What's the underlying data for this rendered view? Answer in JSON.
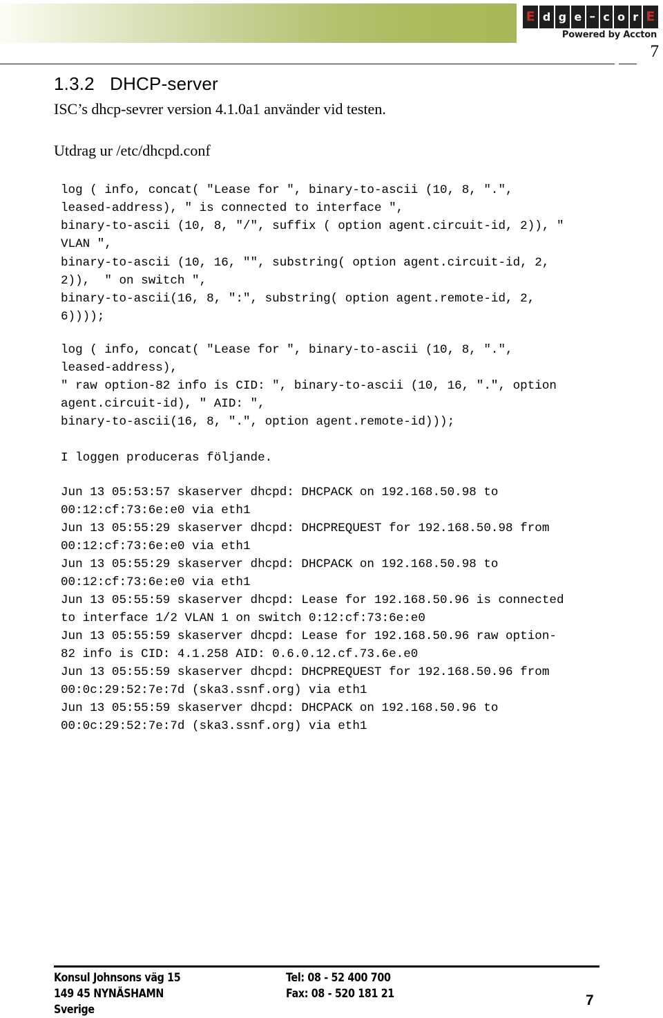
{
  "header": {
    "logo": {
      "tiles": [
        {
          "char": "E",
          "style": "accent"
        },
        {
          "char": "d",
          "style": "plain"
        },
        {
          "char": "g",
          "style": "plain"
        },
        {
          "char": "e",
          "style": "plain"
        },
        {
          "char": "–",
          "style": "dash"
        },
        {
          "char": "c",
          "style": "plain"
        },
        {
          "char": "o",
          "style": "plain"
        },
        {
          "char": "r",
          "style": "plain"
        },
        {
          "char": "E",
          "style": "accent"
        }
      ],
      "tagline": "Powered by Accton",
      "accent_color": "#c42b26",
      "tile_color": "#211f1e"
    },
    "band_color_start": "#fdfdf6",
    "band_color_end": "#a9b857",
    "page_number": "7"
  },
  "content": {
    "section_number": "1.3.2",
    "section_title": "DHCP-server",
    "heading": "1.3.2   DHCP-server",
    "intro_line": "ISC’s dhcp-sevrer version 4.1.0a1 använder vid testen.",
    "excerpt_label": "Utdrag ur /etc/dhcpd.conf",
    "code_config": "log ( info, concat( \"Lease for \", binary-to-ascii (10, 8, \".\",\nleased-address), \" is connected to interface \",\nbinary-to-ascii (10, 8, \"/\", suffix ( option agent.circuit-id, 2)), \"\nVLAN \",\nbinary-to-ascii (10, 16, \"\", substring( option agent.circuit-id, 2,\n2)),  \" on switch \",\nbinary-to-ascii(16, 8, \":\", substring( option agent.remote-id, 2,\n6))));",
    "code_config2": "log ( info, concat( \"Lease for \", binary-to-ascii (10, 8, \".\",\nleased-address),\n\" raw option-82 info is CID: \", binary-to-ascii (10, 16, \".\", option\nagent.circuit-id), \" AID: \",\nbinary-to-ascii(16, 8, \".\", option agent.remote-id)));",
    "log_intro": "I loggen produceras följande.",
    "log_output": "Jun 13 05:53:57 skaserver dhcpd: DHCPACK on 192.168.50.98 to\n00:12:cf:73:6e:e0 via eth1\nJun 13 05:55:29 skaserver dhcpd: DHCPREQUEST for 192.168.50.98 from\n00:12:cf:73:6e:e0 via eth1\nJun 13 05:55:29 skaserver dhcpd: DHCPACK on 192.168.50.98 to\n00:12:cf:73:6e:e0 via eth1\nJun 13 05:55:59 skaserver dhcpd: Lease for 192.168.50.96 is connected\nto interface 1/2 VLAN 1 on switch 0:12:cf:73:6e:e0\nJun 13 05:55:59 skaserver dhcpd: Lease for 192.168.50.96 raw option-\n82 info is CID: 4.1.258 AID: 0.6.0.12.cf.73.6e.e0\nJun 13 05:55:59 skaserver dhcpd: DHCPREQUEST for 192.168.50.96 from\n00:0c:29:52:7e:7d (ska3.ssnf.org) via eth1\nJun 13 05:55:59 skaserver dhcpd: DHCPACK on 192.168.50.96 to\n00:0c:29:52:7e:7d (ska3.ssnf.org) via eth1"
  },
  "footer": {
    "address_lines": [
      "Konsul Johnsons väg 15",
      "149 45 NYNÄSHAMN",
      "Sverige"
    ],
    "contact_lines": [
      "Tel: 08 - 52 400 700",
      "Fax: 08 - 520 181 21",
      ""
    ],
    "page_number": "7"
  }
}
